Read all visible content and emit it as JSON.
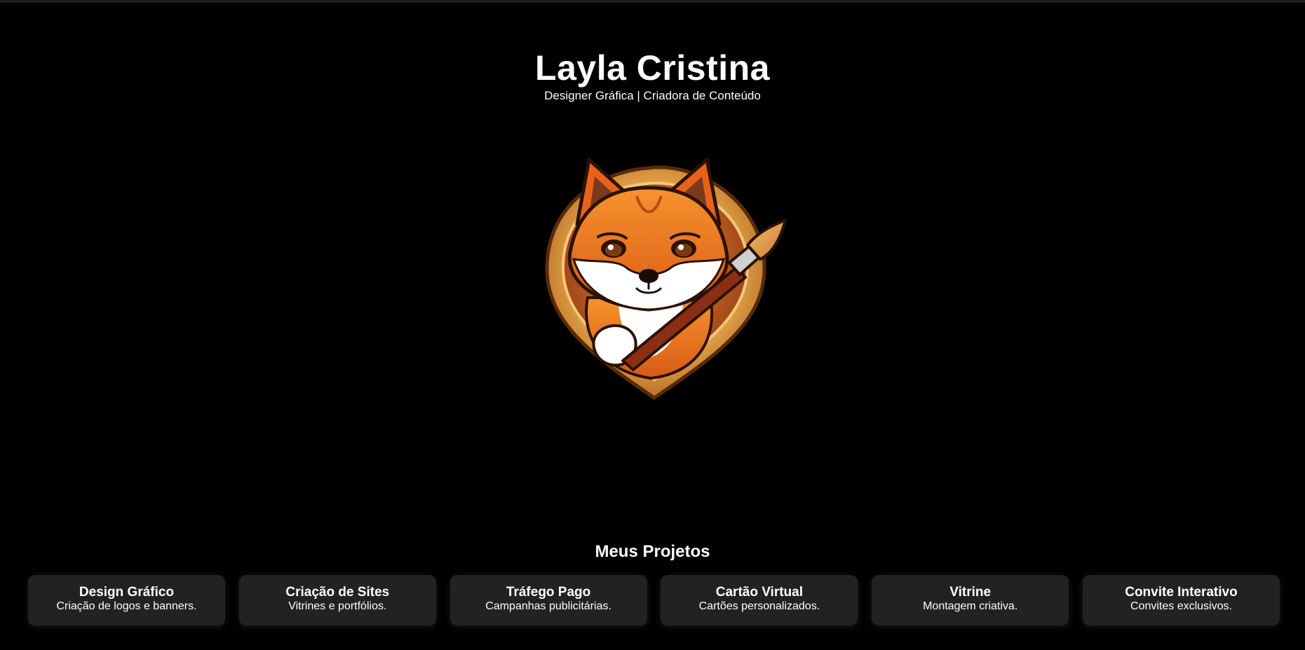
{
  "header": {
    "title": "Layla Cristina",
    "subtitle": "Designer Gráfica | Criadora de Conteúdo"
  },
  "logo": {
    "icon": "fox-mascot-with-paintbrush-icon"
  },
  "projects": {
    "heading": "Meus Projetos",
    "cards": [
      {
        "title": "Design Gráfico",
        "description": "Criação de logos e banners."
      },
      {
        "title": "Criação de Sites",
        "description": "Vitrines e portfólios."
      },
      {
        "title": "Tráfego Pago",
        "description": "Campanhas publicitárias."
      },
      {
        "title": "Cartão Virtual",
        "description": "Cartões personalizados."
      },
      {
        "title": "Vitrine",
        "description": "Montagem criativa."
      },
      {
        "title": "Convite Interativo",
        "description": "Convites exclusivos."
      }
    ]
  },
  "colors": {
    "background": "#000000",
    "card_background": "#222222",
    "text": "#ffffff",
    "fox_orange": "#f07a24",
    "badge_gold": "#e8a64a"
  }
}
